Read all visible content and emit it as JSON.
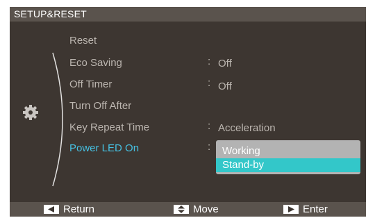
{
  "header": {
    "title": "SETUP&RESET"
  },
  "menu": {
    "items": [
      {
        "label": "Reset",
        "value": "",
        "has_colon": false
      },
      {
        "label": "Eco Saving",
        "value": "Off",
        "has_colon": true
      },
      {
        "label": "Off Timer",
        "value": "Off",
        "has_colon": true
      },
      {
        "label": "Turn Off After",
        "value": "",
        "has_colon": false
      },
      {
        "label": "Key Repeat Time",
        "value": "Acceleration",
        "has_colon": true
      },
      {
        "label": "Power LED On",
        "value": "",
        "has_colon": true,
        "active": true
      }
    ],
    "colon": ":"
  },
  "dropdown": {
    "options": [
      "Working",
      "Stand-by"
    ],
    "selected": "Stand-by"
  },
  "footer": {
    "return_label": "Return",
    "move_label": "Move",
    "enter_label": "Enter"
  },
  "colors": {
    "active_text": "#46c1e2",
    "selected_option": "#33c7c9",
    "background": "#3d3631"
  },
  "icons": {
    "category": "gear-icon",
    "return": "left-arrow-icon",
    "move": "up-down-arrow-icon",
    "enter": "right-arrow-icon"
  }
}
